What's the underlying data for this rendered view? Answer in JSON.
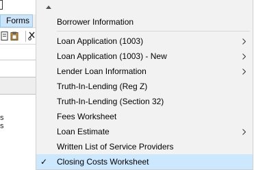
{
  "app": {
    "menubar_label": "Forms",
    "left_fragments": [
      "s",
      "s"
    ]
  },
  "menu": {
    "items": [
      {
        "label": "Borrower Information",
        "has_submenu": false,
        "checked": false
      },
      {
        "label": "Loan Application (1003)",
        "has_submenu": true,
        "checked": false
      },
      {
        "label": "Loan Application (1003) - New",
        "has_submenu": true,
        "checked": false
      },
      {
        "label": "Lender Loan Information",
        "has_submenu": true,
        "checked": false
      },
      {
        "label": "Truth-In-Lending (Reg Z)",
        "has_submenu": false,
        "checked": false
      },
      {
        "label": "Truth-In-Lending (Section 32)",
        "has_submenu": false,
        "checked": false
      },
      {
        "label": "Fees Worksheet",
        "has_submenu": false,
        "checked": false
      },
      {
        "label": "Loan Estimate",
        "has_submenu": true,
        "checked": false
      },
      {
        "label": "Written List of Service Providers",
        "has_submenu": false,
        "checked": false
      },
      {
        "label": "Closing Costs Worksheet",
        "has_submenu": false,
        "checked": true
      }
    ],
    "check_glyph": "✓"
  },
  "colors": {
    "menu_bg": "#f2f2f2",
    "selected_bg": "#cce8ff",
    "forms_highlight": "#cce4f7"
  }
}
